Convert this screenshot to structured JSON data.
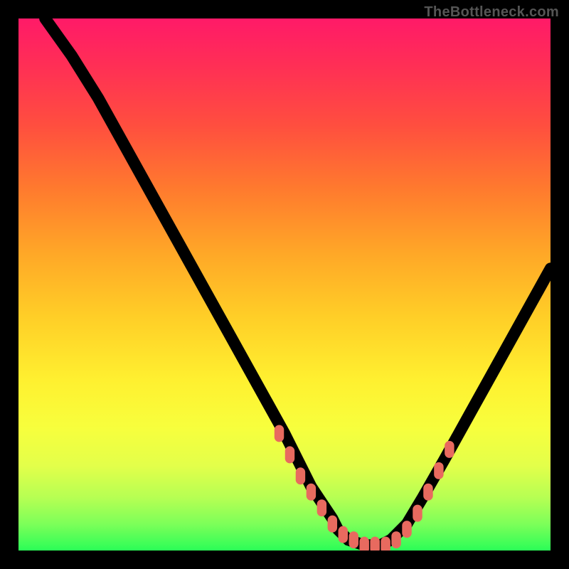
{
  "watermark": "TheBottleneck.com",
  "chart_data": {
    "type": "line",
    "title": "",
    "xlabel": "",
    "ylabel": "",
    "xlim": [
      0,
      100
    ],
    "ylim": [
      0,
      100
    ],
    "curve": {
      "name": "bottleneck-curve",
      "x": [
        5,
        10,
        15,
        20,
        25,
        30,
        35,
        40,
        45,
        50,
        53,
        55,
        57,
        59,
        60,
        62,
        65,
        68,
        70,
        73,
        76,
        80,
        85,
        90,
        95,
        100
      ],
      "y": [
        100,
        93,
        85,
        76,
        67,
        58,
        49,
        40,
        31,
        22,
        16,
        12,
        9,
        6,
        4,
        2,
        1,
        1,
        2,
        5,
        10,
        17,
        26,
        35,
        44,
        53
      ]
    },
    "markers": {
      "name": "highlight-region",
      "x": [
        49,
        51,
        53,
        55,
        57,
        59,
        61,
        63,
        65,
        67,
        69,
        71,
        73,
        75,
        77,
        79,
        81
      ],
      "y": [
        22,
        18,
        14,
        11,
        8,
        5,
        3,
        2,
        1,
        1,
        1,
        2,
        4,
        7,
        11,
        15,
        19
      ]
    },
    "gradient_stops": [
      {
        "pos": 0,
        "color": "#ff1a68"
      },
      {
        "pos": 50,
        "color": "#ffce27"
      },
      {
        "pos": 100,
        "color": "#2bfd57"
      }
    ]
  }
}
